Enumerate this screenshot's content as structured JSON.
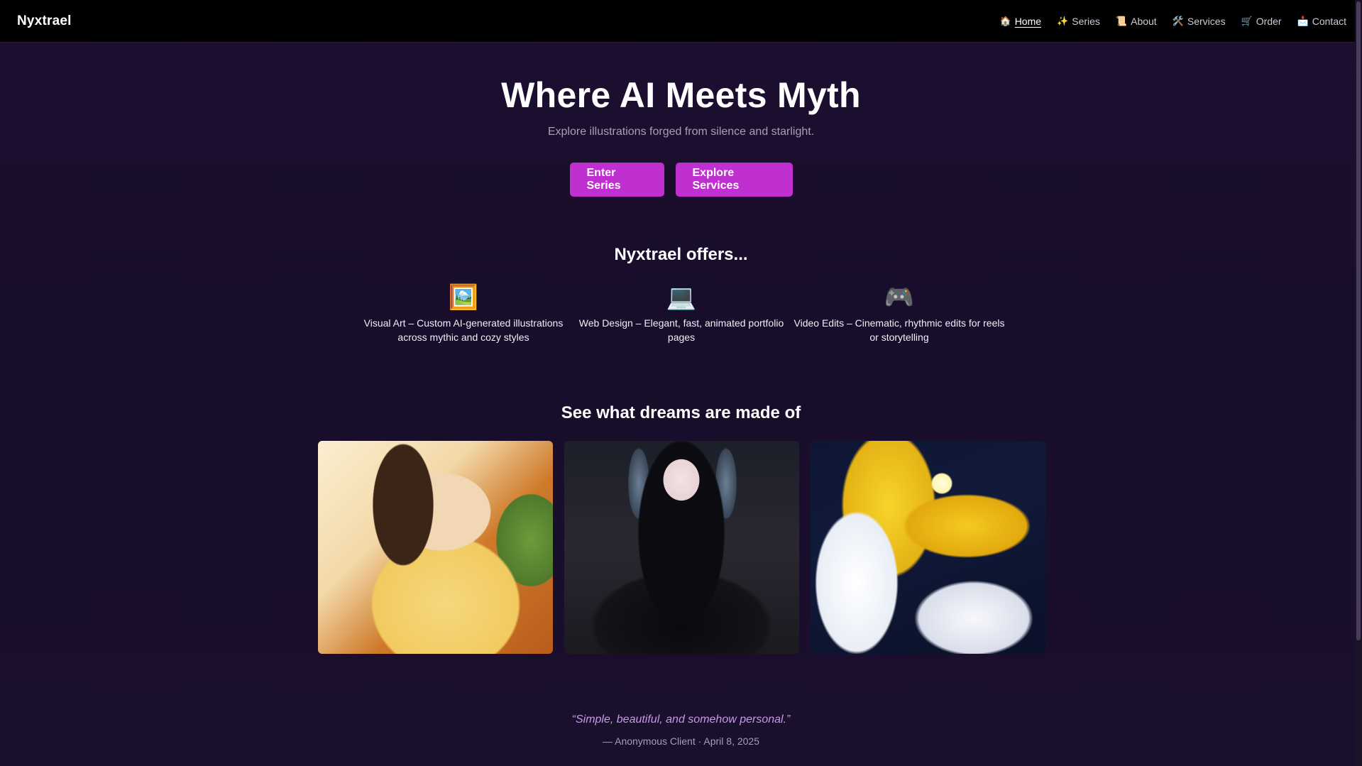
{
  "nav": {
    "brand": "Nyxtrael",
    "links": [
      {
        "icon": "🏠",
        "label": "Home",
        "active": true
      },
      {
        "icon": "✨",
        "label": "Series"
      },
      {
        "icon": "📜",
        "label": "About"
      },
      {
        "icon": "🛠️",
        "label": "Services"
      },
      {
        "icon": "🛒",
        "label": "Order"
      },
      {
        "icon": "📩",
        "label": "Contact"
      }
    ]
  },
  "hero": {
    "title": "Where AI Meets Myth",
    "subtitle": "Explore illustrations forged from silence and starlight.",
    "buttons": [
      "Enter Series",
      "Explore Services"
    ]
  },
  "offers": {
    "title": "Nyxtrael offers...",
    "items": [
      {
        "icon": "🖼️",
        "icon_name": "framed-picture-icon",
        "text": "Visual Art – Custom AI-generated illustrations across mythic and cozy styles"
      },
      {
        "icon": "💻",
        "icon_name": "laptop-icon",
        "text": "Web Design – Elegant, fast, animated portfolio pages"
      },
      {
        "icon": "🎮",
        "icon_name": "game-controller-icon",
        "text": "Video Edits – Cinematic, rhythmic edits for reels or storytelling"
      }
    ]
  },
  "gallery": {
    "title": "See what dreams are made of"
  },
  "testimonial": {
    "quote": "“Simple, beautiful, and somehow personal.”",
    "attribution": "— Anonymous Client · April 8, 2025"
  },
  "colors": {
    "background": "#180d2a",
    "nav_background": "#000000",
    "accent": "#c02fd0",
    "quote": "#c79be6"
  }
}
